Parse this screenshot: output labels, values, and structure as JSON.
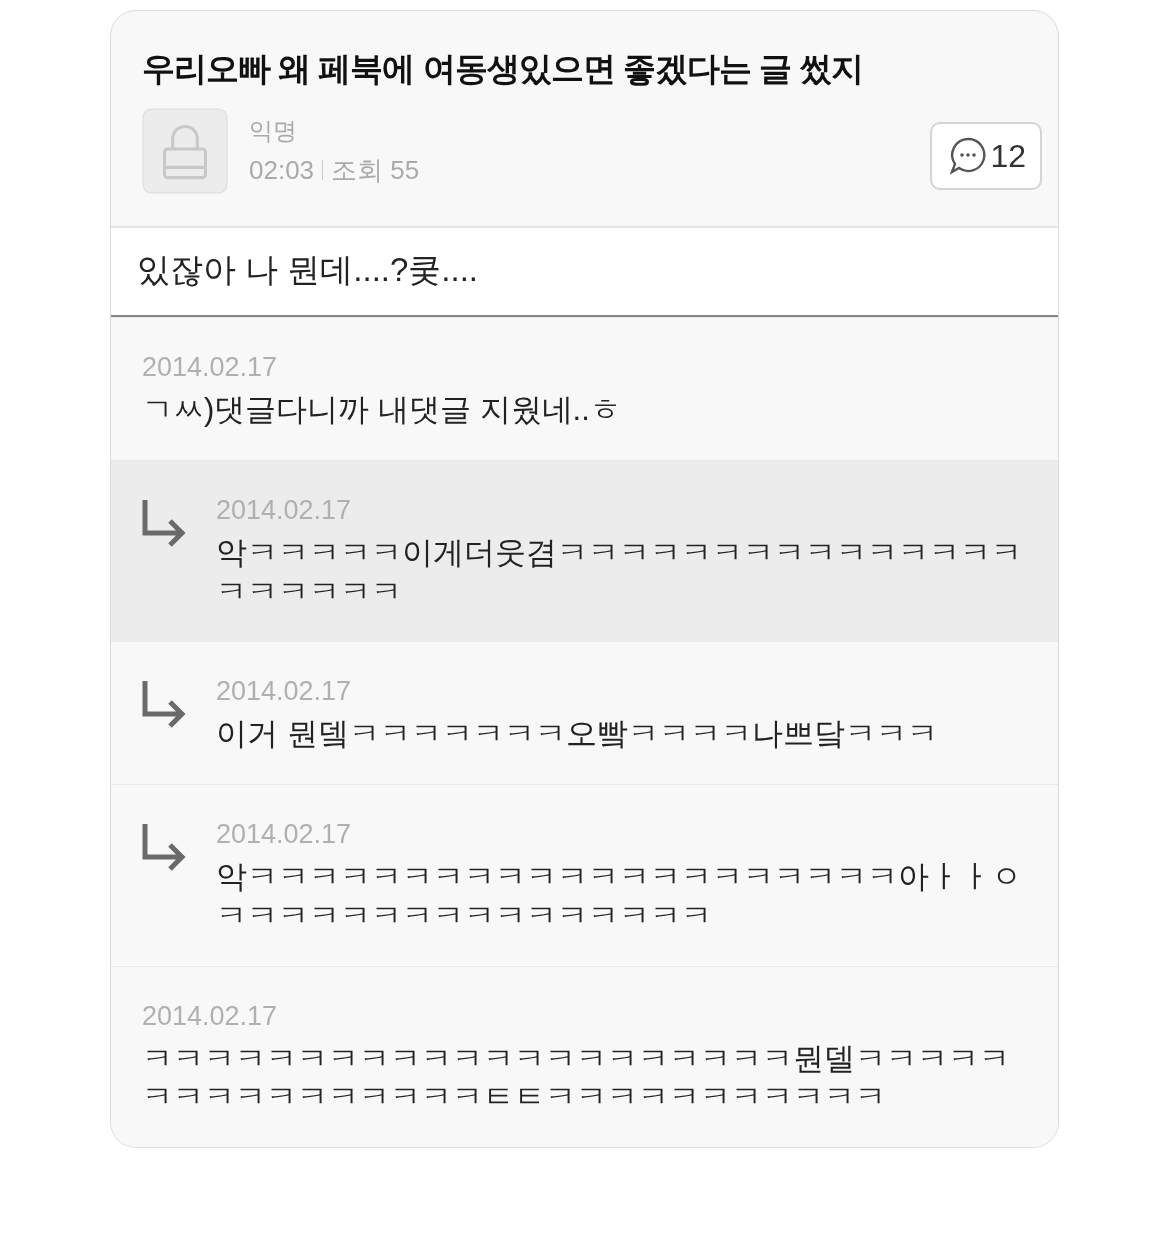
{
  "post": {
    "title": "우리오빠 왜 페북에 여동생있으면 좋겠다는 글 썼지",
    "author": "익명",
    "time": "02:03",
    "views": "조회 55",
    "comment_count": "12",
    "body": "있잖아 나 뭔데....?쿶...."
  },
  "comments": [
    {
      "kind": "comment",
      "highlighted": false,
      "date": "2014.02.17",
      "lines": [
        "ㄱㅆ)댓글다니까 내댓글 지웠네..ㅎ"
      ]
    },
    {
      "kind": "reply",
      "highlighted": true,
      "date": "2014.02.17",
      "lines": [
        "악ㅋㅋㅋㅋㅋ이게더웃겸ㅋㅋㅋㅋㅋㅋㅋㅋㅋㅋㅋㅋㅋㅋㅋ",
        "ㅋㅋㅋㅋㅋㅋ"
      ]
    },
    {
      "kind": "reply",
      "highlighted": false,
      "date": "2014.02.17",
      "lines": [
        "이거 뭔뎈ㅋㅋㅋㅋㅋㅋㅋ오빸ㅋㅋㅋㅋ나쁘닼ㅋㅋㅋ"
      ]
    },
    {
      "kind": "reply",
      "highlighted": false,
      "date": "2014.02.17",
      "lines": [
        "악ㅋㅋㅋㅋㅋㅋㅋㅋㅋㅋㅋㅋㅋㅋㅋㅋㅋㅋㅋㅋㅋ아ㅏㅏㅇ",
        "ㅋㅋㅋㅋㅋㅋㅋㅋㅋㅋㅋㅋㅋㅋㅋㅋ"
      ]
    },
    {
      "kind": "comment",
      "highlighted": false,
      "date": "2014.02.17",
      "lines": [
        "ㅋㅋㅋㅋㅋㅋㅋㅋㅋㅋㅋㅋㅋㅋㅋㅋㅋㅋㅋㅋㅋ뭔델ㅋㅋㅋㅋㅋ",
        "ㅋㅋㅋㅋㅋㅋㅋㅋㅋㅋㅋㅌㅌㅋㅋㅋㅋㅋㅋㅋㅋㅋㅋㅋ"
      ]
    }
  ]
}
